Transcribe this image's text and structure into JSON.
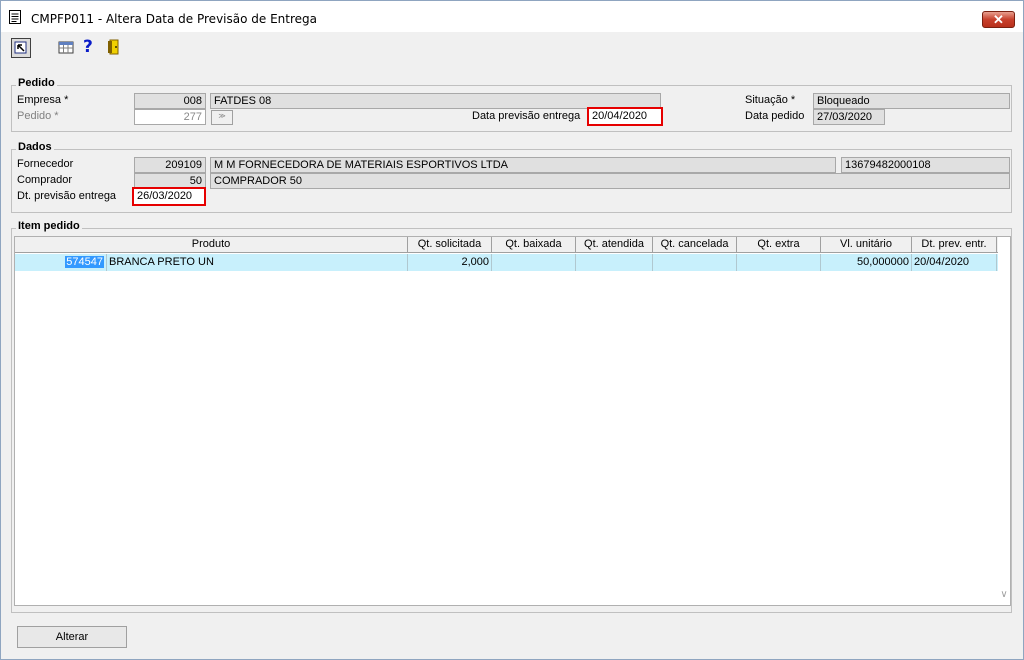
{
  "window": {
    "title": "CMPFP011 - Altera Data de Previsão de Entrega",
    "close_label": "✕"
  },
  "toolbar": {
    "icons": [
      "select-icon",
      "calendar-grid-icon",
      "help-icon",
      "exit-door-icon"
    ],
    "help_glyph": "?"
  },
  "pedido": {
    "group_label": "Pedido",
    "empresa_label": "Empresa *",
    "empresa_code": "008",
    "empresa_name": "FATDES 08",
    "pedido_label": "Pedido *",
    "pedido_value": "277",
    "lookup_glyph": "≫",
    "data_previsao_label": "Data previsão entrega",
    "data_previsao_value": "20/04/2020",
    "situacao_label": "Situação *",
    "situacao_value": "Bloqueado",
    "data_pedido_label": "Data pedido",
    "data_pedido_value": "27/03/2020"
  },
  "dados": {
    "group_label": "Dados",
    "fornecedor_label": "Fornecedor",
    "fornecedor_code": "209109",
    "fornecedor_name": "M M    FORNECEDORA DE MATERIAIS ESPORTIVOS  LTDA",
    "fornecedor_doc": "13679482000108",
    "comprador_label": "Comprador",
    "comprador_code": "50",
    "comprador_name": "COMPRADOR 50",
    "dt_previsao_label": "Dt. previsão entrega",
    "dt_previsao_value": "26/03/2020"
  },
  "itens": {
    "group_label": "Item pedido",
    "columns": [
      "Produto",
      "Qt. solicitada",
      "Qt. baixada",
      "Qt. atendida",
      "Qt. cancelada",
      "Qt. extra",
      "Vl. unitário",
      "Dt. prev. entr."
    ],
    "rows": [
      {
        "codigo": "574547",
        "descricao": "BRANCA PRETO UN",
        "qt_solicitada": "2,000",
        "qt_baixada": "",
        "qt_atendida": "",
        "qt_cancelada": "",
        "qt_extra": "",
        "vl_unitario": "50,000000",
        "dt_prev_entr": "20/04/2020"
      }
    ]
  },
  "actions": {
    "alterar_label": "Alterar"
  },
  "colors": {
    "highlight_border": "#e60000",
    "selected_row": "#c8f0fc",
    "selected_text_bg": "#3399ff"
  }
}
